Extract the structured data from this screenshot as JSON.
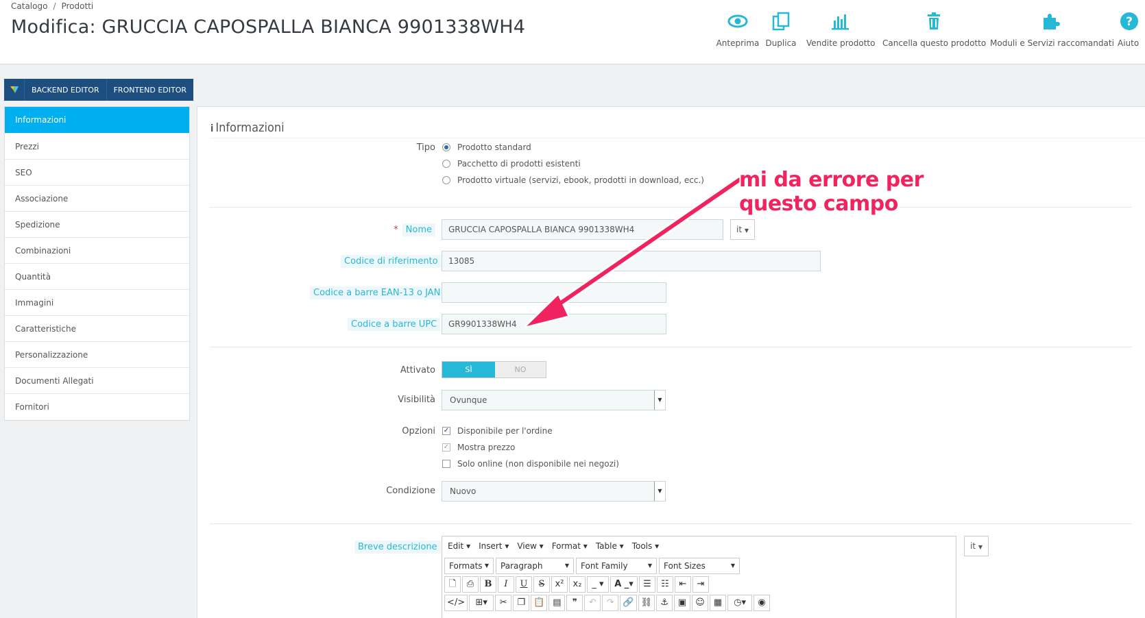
{
  "breadcrumb": {
    "items": [
      "Catalogo",
      "Prodotti"
    ],
    "separator": "/"
  },
  "page_title": "Modifica: GRUCCIA CAPOSPALLA BIANCA 9901338WH4",
  "toolbar": {
    "preview": "Anteprima",
    "duplicate": "Duplica",
    "sales": "Vendite prodotto",
    "delete": "Cancella questo prodotto",
    "modules": "Moduli e Servizi raccomandati",
    "help": "Aiuto"
  },
  "editor_bar": {
    "backend": "BACKEND EDITOR",
    "frontend": "FRONTEND EDITOR"
  },
  "sidenav": {
    "items": [
      "Informazioni",
      "Prezzi",
      "SEO",
      "Associazione",
      "Spedizione",
      "Combinazioni",
      "Quantità",
      "Immagini",
      "Caratteristiche",
      "Personalizzazione",
      "Documenti Allegati",
      "Fornitori"
    ],
    "active_index": 0
  },
  "panel": {
    "heading": "Informazioni"
  },
  "form": {
    "tipo": {
      "label": "Tipo",
      "options": [
        "Prodotto standard",
        "Pacchetto di prodotti esistenti",
        "Prodotto virtuale (servizi, ebook, prodotti in download, ecc.)"
      ],
      "selected": 0
    },
    "nome": {
      "required": "*",
      "label": "Nome",
      "value": "GRUCCIA CAPOSPALLA BIANCA 9901338WH4",
      "lang": "it"
    },
    "riferimento": {
      "label": "Codice di riferimento",
      "value": "13085"
    },
    "ean": {
      "label": "Codice a barre EAN-13 o JAN",
      "value": ""
    },
    "upc": {
      "label": "Codice a barre UPC",
      "value": "GR9901338WH4"
    },
    "attivato": {
      "label": "Attivato",
      "on": "SÌ",
      "off": "NO"
    },
    "visibilita": {
      "label": "Visibilità",
      "value": "Ovunque"
    },
    "opzioni": {
      "label": "Opzioni",
      "items": [
        {
          "label": "Disponibile per l'ordine",
          "checked": true
        },
        {
          "label": "Mostra prezzo",
          "checked": true
        },
        {
          "label": "Solo online (non disponibile nei negozi)",
          "checked": false
        }
      ]
    },
    "condizione": {
      "label": "Condizione",
      "value": "Nuovo"
    },
    "breve_descrizione": {
      "label": "Breve descrizione",
      "lang": "it"
    }
  },
  "tinymce": {
    "menus": [
      "Edit",
      "Insert",
      "View",
      "Format",
      "Table",
      "Tools"
    ],
    "dropdowns": [
      "Formats",
      "Paragraph",
      "Font Family",
      "Font Sizes"
    ]
  },
  "annotation": {
    "line1": "mi da errore per",
    "line2": "questo campo",
    "color": "#f0245e"
  },
  "colors": {
    "accent": "#00aff0",
    "label_hint": "#25b9d7",
    "editor_bar": "#1c4e80"
  }
}
